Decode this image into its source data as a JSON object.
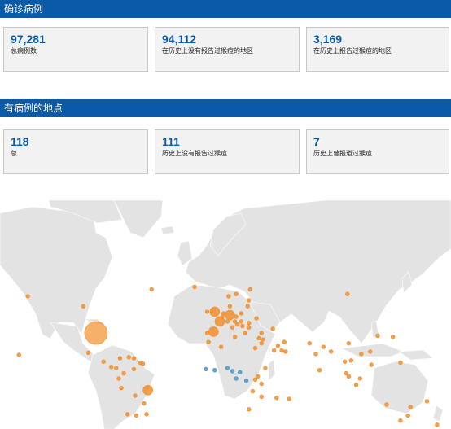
{
  "confirmed": {
    "title": "确诊病例",
    "cards": [
      {
        "value": "97,281",
        "label": "总病例数"
      },
      {
        "value": "94,112",
        "label": "在历史上没有报告过猴痘的地区"
      },
      {
        "value": "3,169",
        "label": "在历史上报告过猴痘的地区"
      }
    ]
  },
  "locations": {
    "title": "有病例的地点",
    "cards": [
      {
        "value": "118",
        "label": "总"
      },
      {
        "value": "111",
        "label": "历史上没有报告过猴痘"
      },
      {
        "value": "7",
        "label": "历史上曾报道过猴痘"
      }
    ]
  },
  "map": {
    "colors": {
      "ocean": "#ffffff",
      "land": "#e3e3e3",
      "border": "#ffffff",
      "non_endemic": "#f28e2b",
      "endemic": "#4e97c4"
    },
    "markers": [
      {
        "lon": -96,
        "lat": 39,
        "cat": "non_endemic",
        "size": "large"
      },
      {
        "lon": -55,
        "lat": -12,
        "cat": "non_endemic",
        "size": "medium"
      },
      {
        "lon": -3,
        "lat": 40,
        "cat": "non_endemic",
        "size": "medium"
      },
      {
        "lon": 10,
        "lat": 51,
        "cat": "non_endemic",
        "size": "medium"
      },
      {
        "lon": 2,
        "lat": 47,
        "cat": "non_endemic",
        "size": "medium"
      },
      {
        "lon": -2,
        "lat": 53,
        "cat": "non_endemic",
        "size": "medium"
      },
      {
        "lon": -106,
        "lat": 56,
        "cat": "non_endemic",
        "size": "small"
      },
      {
        "lon": -102,
        "lat": 23,
        "cat": "non_endemic",
        "size": "small"
      },
      {
        "lon": -74,
        "lat": 4,
        "cat": "non_endemic",
        "size": "small"
      },
      {
        "lon": -76,
        "lat": -10,
        "cat": "non_endemic",
        "size": "small"
      },
      {
        "lon": -71,
        "lat": -33,
        "cat": "non_endemic",
        "size": "small"
      },
      {
        "lon": -64,
        "lat": -34,
        "cat": "non_endemic",
        "size": "small"
      },
      {
        "lon": -78,
        "lat": -1,
        "cat": "non_endemic",
        "size": "small"
      },
      {
        "lon": -66,
        "lat": 18,
        "cat": "non_endemic",
        "size": "small"
      },
      {
        "lon": -84,
        "lat": 10,
        "cat": "non_endemic",
        "size": "small"
      },
      {
        "lon": -80,
        "lat": 9,
        "cat": "non_endemic",
        "size": "small"
      },
      {
        "lon": -90,
        "lat": 15,
        "cat": "non_endemic",
        "size": "small"
      },
      {
        "lon": -77,
        "lat": 18,
        "cat": "non_endemic",
        "size": "small"
      },
      {
        "lon": -70,
        "lat": 19,
        "cat": "non_endemic",
        "size": "small"
      },
      {
        "lon": -66,
        "lat": 8,
        "cat": "non_endemic",
        "size": "small"
      },
      {
        "lon": -56,
        "lat": -33,
        "cat": "non_endemic",
        "size": "small"
      },
      {
        "lon": -58,
        "lat": -24,
        "cat": "non_endemic",
        "size": "small"
      },
      {
        "lon": -65,
        "lat": -17,
        "cat": "non_endemic",
        "size": "small"
      },
      {
        "lon": -61,
        "lat": 14,
        "cat": "non_endemic",
        "size": "small"
      },
      {
        "lon": -59,
        "lat": 13,
        "cat": "non_endemic",
        "size": "small"
      },
      {
        "lon": -150,
        "lat": 61,
        "cat": "non_endemic",
        "size": "small"
      },
      {
        "lon": -157,
        "lat": 21,
        "cat": "non_endemic",
        "size": "small"
      },
      {
        "lon": -52,
        "lat": 64,
        "cat": "non_endemic",
        "size": "small"
      },
      {
        "lon": -18,
        "lat": 65,
        "cat": "non_endemic",
        "size": "small"
      },
      {
        "lon": -8,
        "lat": 53,
        "cat": "non_endemic",
        "size": "small"
      },
      {
        "lon": -8,
        "lat": 39,
        "cat": "non_endemic",
        "size": "small"
      },
      {
        "lon": 4,
        "lat": 50,
        "cat": "non_endemic",
        "size": "small"
      },
      {
        "lon": 5,
        "lat": 52,
        "cat": "non_endemic",
        "size": "small"
      },
      {
        "lon": 8,
        "lat": 47,
        "cat": "non_endemic",
        "size": "small"
      },
      {
        "lon": 14,
        "lat": 47,
        "cat": "non_endemic",
        "size": "small"
      },
      {
        "lon": 12,
        "lat": 43,
        "cat": "non_endemic",
        "size": "small"
      },
      {
        "lon": 10,
        "lat": 56,
        "cat": "non_endemic",
        "size": "small"
      },
      {
        "lon": 15,
        "lat": 62,
        "cat": "non_endemic",
        "size": "small"
      },
      {
        "lon": 9,
        "lat": 61,
        "cat": "non_endemic",
        "size": "small"
      },
      {
        "lon": 26,
        "lat": 64,
        "cat": "non_endemic",
        "size": "small"
      },
      {
        "lon": 19,
        "lat": 52,
        "cat": "non_endemic",
        "size": "small"
      },
      {
        "lon": 15,
        "lat": 50,
        "cat": "non_endemic",
        "size": "small"
      },
      {
        "lon": 19,
        "lat": 47,
        "cat": "non_endemic",
        "size": "small"
      },
      {
        "lon": 25,
        "lat": 46,
        "cat": "non_endemic",
        "size": "small"
      },
      {
        "lon": 22,
        "lat": 39,
        "cat": "non_endemic",
        "size": "small"
      },
      {
        "lon": 35,
        "lat": 39,
        "cat": "non_endemic",
        "size": "small"
      },
      {
        "lon": 31,
        "lat": 49,
        "cat": "non_endemic",
        "size": "small"
      },
      {
        "lon": 24,
        "lat": 56,
        "cat": "non_endemic",
        "size": "small"
      },
      {
        "lon": 25,
        "lat": 59,
        "cat": "non_endemic",
        "size": "small"
      },
      {
        "lon": 16,
        "lat": 45,
        "cat": "non_endemic",
        "size": "small"
      },
      {
        "lon": 20,
        "lat": 44,
        "cat": "non_endemic",
        "size": "small"
      },
      {
        "lon": 25,
        "lat": 43,
        "cat": "non_endemic",
        "size": "small"
      },
      {
        "lon": 33,
        "lat": 35,
        "cat": "non_endemic",
        "size": "small"
      },
      {
        "lon": 14,
        "lat": 36,
        "cat": "non_endemic",
        "size": "small"
      },
      {
        "lon": 44,
        "lat": 42,
        "cat": "non_endemic",
        "size": "small"
      },
      {
        "lon": 35,
        "lat": 31,
        "cat": "non_endemic",
        "size": "small"
      },
      {
        "lon": 36,
        "lat": 34,
        "cat": "non_endemic",
        "size": "small"
      },
      {
        "lon": 45,
        "lat": 25,
        "cat": "non_endemic",
        "size": "small"
      },
      {
        "lon": 54,
        "lat": 24,
        "cat": "non_endemic",
        "size": "small"
      },
      {
        "lon": 51,
        "lat": 25,
        "cat": "non_endemic",
        "size": "small"
      },
      {
        "lon": 48,
        "lat": 29,
        "cat": "non_endemic",
        "size": "small"
      },
      {
        "lon": 53,
        "lat": 32,
        "cat": "non_endemic",
        "size": "small"
      },
      {
        "lon": 30,
        "lat": 27,
        "cat": "non_endemic",
        "size": "small"
      },
      {
        "lon": -7,
        "lat": 32,
        "cat": "non_endemic",
        "size": "small"
      },
      {
        "lon": 3,
        "lat": 28,
        "cat": "non_endemic",
        "size": "small"
      },
      {
        "lon": 38,
        "lat": 9,
        "cat": "non_endemic",
        "size": "small"
      },
      {
        "lon": 32,
        "lat": 1,
        "cat": "non_endemic",
        "size": "small"
      },
      {
        "lon": 35,
        "lat": -6,
        "cat": "non_endemic",
        "size": "small"
      },
      {
        "lon": 30,
        "lat": -2,
        "cat": "non_endemic",
        "size": "small"
      },
      {
        "lon": 28,
        "lat": -13,
        "cat": "non_endemic",
        "size": "small"
      },
      {
        "lon": 35,
        "lat": -18,
        "cat": "non_endemic",
        "size": "small"
      },
      {
        "lon": 25,
        "lat": -29,
        "cat": "non_endemic",
        "size": "small"
      },
      {
        "lon": 47,
        "lat": -19,
        "cat": "non_endemic",
        "size": "small"
      },
      {
        "lon": 57,
        "lat": -20,
        "cat": "non_endemic",
        "size": "small"
      },
      {
        "lon": 78,
        "lat": 22,
        "cat": "non_endemic",
        "size": "small"
      },
      {
        "lon": 73,
        "lat": 31,
        "cat": "non_endemic",
        "size": "small"
      },
      {
        "lon": 81,
        "lat": 7,
        "cat": "non_endemic",
        "size": "small"
      },
      {
        "lon": 84,
        "lat": 28,
        "cat": "non_endemic",
        "size": "small"
      },
      {
        "lon": 90,
        "lat": 24,
        "cat": "non_endemic",
        "size": "small"
      },
      {
        "lon": 101,
        "lat": 15,
        "cat": "non_endemic",
        "size": "small"
      },
      {
        "lon": 106,
        "lat": 16,
        "cat": "non_endemic",
        "size": "small"
      },
      {
        "lon": 102,
        "lat": 4,
        "cat": "non_endemic",
        "size": "small"
      },
      {
        "lon": 104,
        "lat": 1,
        "cat": "non_endemic",
        "size": "small"
      },
      {
        "lon": 113,
        "lat": -1,
        "cat": "non_endemic",
        "size": "small"
      },
      {
        "lon": 110,
        "lat": -7,
        "cat": "non_endemic",
        "size": "small"
      },
      {
        "lon": 122,
        "lat": 12,
        "cat": "non_endemic",
        "size": "small"
      },
      {
        "lon": 114,
        "lat": 22,
        "cat": "non_endemic",
        "size": "small"
      },
      {
        "lon": 121,
        "lat": 24,
        "cat": "non_endemic",
        "size": "small"
      },
      {
        "lon": 127,
        "lat": 37,
        "cat": "non_endemic",
        "size": "small"
      },
      {
        "lon": 139,
        "lat": 36,
        "cat": "non_endemic",
        "size": "small"
      },
      {
        "lon": 104,
        "lat": 31,
        "cat": "non_endemic",
        "size": "small"
      },
      {
        "lon": 103,
        "lat": 62,
        "cat": "non_endemic",
        "size": "small"
      },
      {
        "lon": 145,
        "lat": 14,
        "cat": "non_endemic",
        "size": "small"
      },
      {
        "lon": 134,
        "lat": -25,
        "cat": "non_endemic",
        "size": "small"
      },
      {
        "lon": 151,
        "lat": -34,
        "cat": "non_endemic",
        "size": "small"
      },
      {
        "lon": 145,
        "lat": -38,
        "cat": "non_endemic",
        "size": "small"
      },
      {
        "lon": 153,
        "lat": -27,
        "cat": "non_endemic",
        "size": "small"
      },
      {
        "lon": 174,
        "lat": -41,
        "cat": "non_endemic",
        "size": "small"
      },
      {
        "lon": 166,
        "lat": -22,
        "cat": "non_endemic",
        "size": "small"
      },
      {
        "lon": -9,
        "lat": 8,
        "cat": "endemic",
        "size": "small"
      },
      {
        "lon": -2,
        "lat": 7,
        "cat": "endemic",
        "size": "small"
      },
      {
        "lon": 8,
        "lat": 9,
        "cat": "endemic",
        "size": "small"
      },
      {
        "lon": 12,
        "lat": 6,
        "cat": "endemic",
        "size": "small"
      },
      {
        "lon": 18,
        "lat": 5,
        "cat": "endemic",
        "size": "small"
      },
      {
        "lon": 15,
        "lat": -1,
        "cat": "endemic",
        "size": "small"
      },
      {
        "lon": 23,
        "lat": -3,
        "cat": "endemic",
        "size": "small"
      }
    ]
  }
}
